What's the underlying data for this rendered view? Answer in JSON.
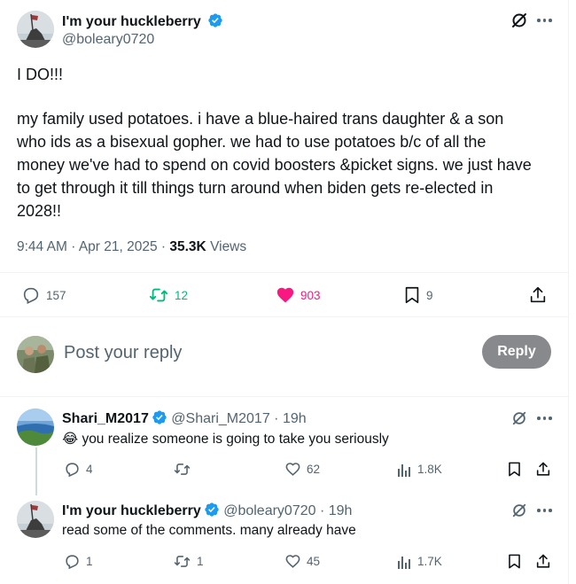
{
  "main_post": {
    "author_name": "I'm your huckleberry",
    "author_handle": "@boleary0720",
    "text_line1": "I DO!!!",
    "text_lines": [
      "my family used potatoes. i have a blue-haired trans daughter & a son",
      "who ids as a bisexual gopher. we had to use potatoes b/c of all the",
      "money we've had to spend on covid boosters &picket signs. we just have",
      "to get through it till things turn around when biden gets re-elected in",
      "2028!!"
    ],
    "time": "9:44 AM",
    "sep1": "·",
    "date": "Apr 21, 2025",
    "sep2": "·",
    "views_count": "35.3K",
    "views_label": "Views",
    "stats": {
      "replies": "157",
      "reposts": "12",
      "likes": "903",
      "bookmarks": "9"
    }
  },
  "compose": {
    "placeholder": "Post your reply",
    "button_label": "Reply"
  },
  "replies": [
    {
      "name": "Shari_M2017",
      "handle": "@Shari_M2017",
      "time": "· 19h",
      "emoji": "😂",
      "text": "you realize someone is going to take you seriously",
      "reply_count": "4",
      "repost_count": "",
      "like_count": "62",
      "view_count": "1.8K"
    },
    {
      "name": "I'm your huckleberry",
      "handle": "@boleary0720",
      "time": "· 19h",
      "emoji": "",
      "text": "read some of the comments. many already have",
      "reply_count": "1",
      "repost_count": "1",
      "like_count": "45",
      "view_count": "1.7K"
    }
  ],
  "colors": {
    "verified": "#1d9bf0",
    "repost": "#00ba7c",
    "like": "#f91880",
    "muted": "#536471",
    "text": "#0f1419",
    "reply_button_bg": "#87898c"
  },
  "icons": {
    "grok": "grok-icon",
    "more": "more-icon",
    "reply": "reply-icon",
    "repost": "repost-icon",
    "like": "heart-icon",
    "bookmark": "bookmark-icon",
    "share": "share-icon",
    "views": "views-icon",
    "verified": "verified-icon"
  }
}
